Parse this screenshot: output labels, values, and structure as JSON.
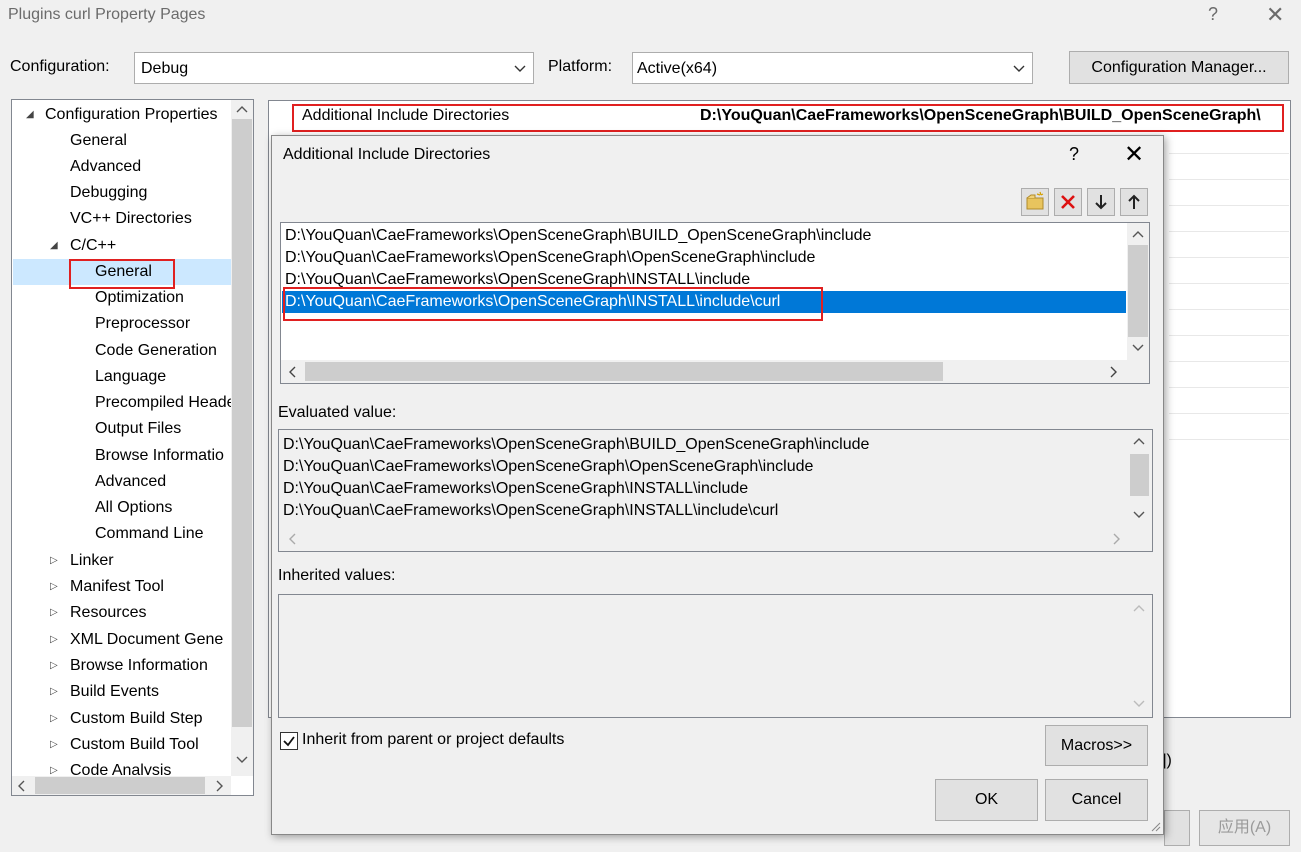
{
  "window": {
    "title": "Plugins curl Property Pages",
    "help": "?",
    "close": "✕"
  },
  "toolbar": {
    "configuration_label": "Configuration:",
    "configuration_value": "Debug",
    "platform_label": "Platform:",
    "platform_value": "Active(x64)",
    "config_manager": "Configuration Manager..."
  },
  "tree": {
    "items": [
      {
        "label": "Configuration Properties",
        "arrow": "◢"
      },
      {
        "label": "General"
      },
      {
        "label": "Advanced"
      },
      {
        "label": "Debugging"
      },
      {
        "label": "VC++ Directories"
      },
      {
        "label": "C/C++",
        "arrow": "◢"
      },
      {
        "label": "General"
      },
      {
        "label": "Optimization"
      },
      {
        "label": "Preprocessor"
      },
      {
        "label": "Code Generation"
      },
      {
        "label": "Language"
      },
      {
        "label": "Precompiled Heade"
      },
      {
        "label": "Output Files"
      },
      {
        "label": "Browse Informatio"
      },
      {
        "label": "Advanced"
      },
      {
        "label": "All Options"
      },
      {
        "label": "Command Line"
      },
      {
        "label": "Linker",
        "arrow": "▷"
      },
      {
        "label": "Manifest Tool",
        "arrow": "▷"
      },
      {
        "label": "Resources",
        "arrow": "▷"
      },
      {
        "label": "XML Document Gene",
        "arrow": "▷"
      },
      {
        "label": "Browse Information",
        "arrow": "▷"
      },
      {
        "label": "Build Events",
        "arrow": "▷"
      },
      {
        "label": "Custom Build Step",
        "arrow": "▷"
      },
      {
        "label": "Custom Build Tool",
        "arrow": "▷"
      },
      {
        "label": "Code Analysis",
        "arrow": "▷"
      }
    ]
  },
  "property": {
    "name": "Additional Include Directories",
    "value": "D:\\YouQuan\\CaeFrameworks\\OpenSceneGraph\\BUILD_OpenSceneGraph\\"
  },
  "dialog": {
    "title": "Additional Include Directories",
    "help": "?",
    "close": "✕",
    "entries": [
      "D:\\YouQuan\\CaeFrameworks\\OpenSceneGraph\\BUILD_OpenSceneGraph\\include",
      "D:\\YouQuan\\CaeFrameworks\\OpenSceneGraph\\OpenSceneGraph\\include",
      "D:\\YouQuan\\CaeFrameworks\\OpenSceneGraph\\INSTALL\\include",
      "D:\\YouQuan\\CaeFrameworks\\OpenSceneGraph\\INSTALL\\include\\curl"
    ],
    "evaluated_label": "Evaluated value:",
    "evaluated": [
      "D:\\YouQuan\\CaeFrameworks\\OpenSceneGraph\\BUILD_OpenSceneGraph\\include",
      "D:\\YouQuan\\CaeFrameworks\\OpenSceneGraph\\OpenSceneGraph\\include",
      "D:\\YouQuan\\CaeFrameworks\\OpenSceneGraph\\INSTALL\\include",
      "D:\\YouQuan\\CaeFrameworks\\OpenSceneGraph\\INSTALL\\include\\curl"
    ],
    "inherited_label": "Inherited values:",
    "inherit_checkbox": "Inherit from parent or project defaults",
    "macros": "Macros>>",
    "ok": "OK",
    "cancel": "Cancel"
  },
  "bottom": {
    "apply": "应用(A)",
    "partial": "])"
  },
  "colors": {
    "highlight": "#0078d7",
    "tree_selected": "#cce8ff",
    "annotation": "#e02020"
  }
}
